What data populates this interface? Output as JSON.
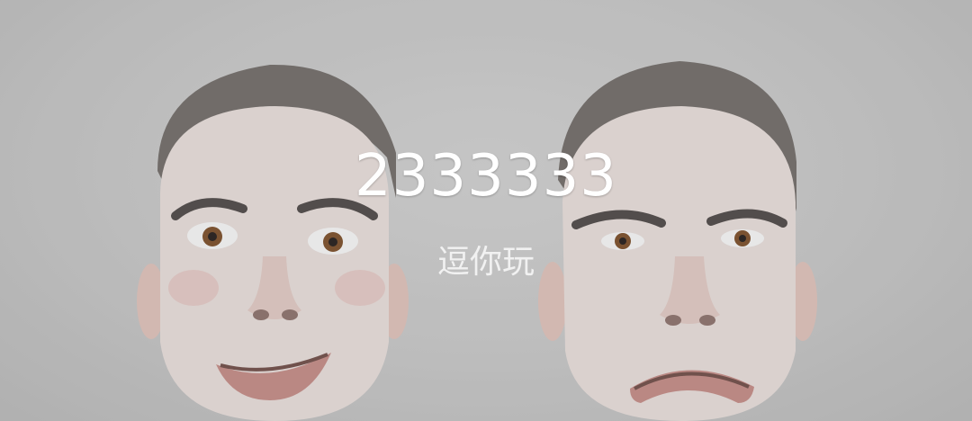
{
  "banner": {
    "title": "2333333",
    "subtitle": "逗你玩",
    "image_icon": "two-faces-photo",
    "colors": {
      "title": "#ffffff",
      "subtitle": "#ececec",
      "background": "#cbcbcb"
    }
  }
}
